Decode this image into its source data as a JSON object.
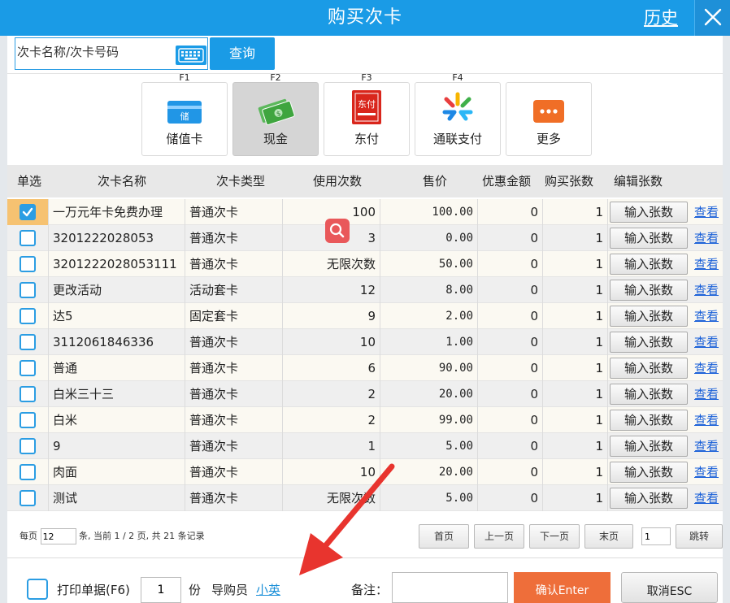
{
  "window": {
    "title": "购买次卡",
    "history_link": "历史",
    "close_icon": "close-icon"
  },
  "search": {
    "placeholder": "次卡名称/次卡号码",
    "button": "查询",
    "keyboard_icon": "keyboard-icon"
  },
  "payment_methods": [
    {
      "key": "F1",
      "label": "储值卡",
      "icon": "stored-value-card-icon",
      "active": false
    },
    {
      "key": "F2",
      "label": "现金",
      "icon": "cash-icon",
      "active": true
    },
    {
      "key": "F3",
      "label": "东付",
      "icon": "jdpay-icon",
      "active": false
    },
    {
      "key": "F4",
      "label": "通联支付",
      "icon": "allinpay-icon",
      "active": false
    },
    {
      "key": "",
      "label": "更多",
      "icon": "more-icon",
      "active": false
    }
  ],
  "table": {
    "headers": [
      "单选",
      "次卡名称",
      "次卡类型",
      "使用次数",
      "售价",
      "优惠金额",
      "购买张数",
      "编辑张数"
    ],
    "input_button": "输入张数",
    "view_link": "查看",
    "rows": [
      {
        "selected": true,
        "name": "一万元年卡免费办理",
        "type": "普通次卡",
        "uses": "100",
        "price": "100.00",
        "discount": "0",
        "qty": "1"
      },
      {
        "selected": false,
        "name": "3201222028053",
        "type": "普通次卡",
        "uses": "3",
        "price": "0.00",
        "discount": "0",
        "qty": "1"
      },
      {
        "selected": false,
        "name": "3201222028053111",
        "type": "普通次卡",
        "uses": "无限次数",
        "price": "50.00",
        "discount": "0",
        "qty": "1"
      },
      {
        "selected": false,
        "name": "更改活动",
        "type": "活动套卡",
        "uses": "12",
        "price": "8.00",
        "discount": "0",
        "qty": "1"
      },
      {
        "selected": false,
        "name": "达5",
        "type": "固定套卡",
        "uses": "9",
        "price": "2.00",
        "discount": "0",
        "qty": "1"
      },
      {
        "selected": false,
        "name": "3112061846336",
        "type": "普通次卡",
        "uses": "10",
        "price": "1.00",
        "discount": "0",
        "qty": "1"
      },
      {
        "selected": false,
        "name": "普通",
        "type": "普通次卡",
        "uses": "6",
        "price": "90.00",
        "discount": "0",
        "qty": "1"
      },
      {
        "selected": false,
        "name": "白米三十三",
        "type": "普通次卡",
        "uses": "2",
        "price": "20.00",
        "discount": "0",
        "qty": "1"
      },
      {
        "selected": false,
        "name": "白米",
        "type": "普通次卡",
        "uses": "2",
        "price": "99.00",
        "discount": "0",
        "qty": "1"
      },
      {
        "selected": false,
        "name": "9",
        "type": "普通次卡",
        "uses": "1",
        "price": "5.00",
        "discount": "0",
        "qty": "1"
      },
      {
        "selected": false,
        "name": "肉面",
        "type": "普通次卡",
        "uses": "10",
        "price": "20.00",
        "discount": "0",
        "qty": "1"
      },
      {
        "selected": false,
        "name": "测试",
        "type": "普通次卡",
        "uses": "无限次数",
        "price": "5.00",
        "discount": "0",
        "qty": "1"
      }
    ]
  },
  "pager": {
    "per_page_label": "每页",
    "per_page_value": "12",
    "info": "条, 当前 1 / 2 页, 共 21 条记录",
    "first": "首页",
    "prev": "上一页",
    "next": "下一页",
    "last": "末页",
    "goto_value": "1",
    "goto": "跳转"
  },
  "footer": {
    "print_label": "打印单据(F6)",
    "copies_value": "1",
    "copies_unit": "份",
    "guide_label": "导购员",
    "guide_name": "小英",
    "remark_label": "备注：",
    "confirm": "确认Enter",
    "cancel": "取消ESC"
  },
  "colors": {
    "title_bar": "#1a9be6",
    "accent": "#2b9de3",
    "selected_cell": "#f6c271",
    "confirm": "#ee6e3a",
    "link": "#1a60d8",
    "annotation_arrow": "#e8342e"
  }
}
